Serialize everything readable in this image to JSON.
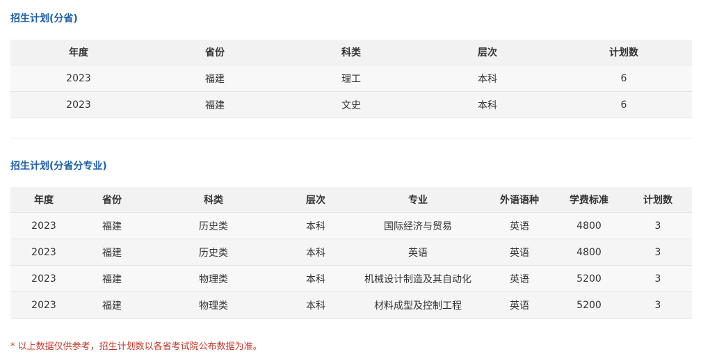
{
  "plan_by_province": {
    "title": "招生计划(分省)",
    "headers": [
      "年度",
      "省份",
      "科类",
      "层次",
      "计划数"
    ],
    "rows": [
      [
        "2023",
        "福建",
        "理工",
        "本科",
        "6"
      ],
      [
        "2023",
        "福建",
        "文史",
        "本科",
        "6"
      ]
    ]
  },
  "plan_by_major": {
    "title": "招生计划(分省分专业)",
    "headers": [
      "年度",
      "省份",
      "科类",
      "层次",
      "专业",
      "外语语种",
      "学费标准",
      "计划数"
    ],
    "rows": [
      [
        "2023",
        "福建",
        "历史类",
        "本科",
        "国际经济与贸易",
        "英语",
        "4800",
        "3"
      ],
      [
        "2023",
        "福建",
        "历史类",
        "本科",
        "英语",
        "英语",
        "4800",
        "3"
      ],
      [
        "2023",
        "福建",
        "物理类",
        "本科",
        "机械设计制造及其自动化",
        "英语",
        "5200",
        "3"
      ],
      [
        "2023",
        "福建",
        "物理类",
        "本科",
        "材料成型及控制工程",
        "英语",
        "5200",
        "3"
      ]
    ]
  },
  "footnote": "* 以上数据仅供参考，招生计划数以各省考试院公布数据为准。"
}
